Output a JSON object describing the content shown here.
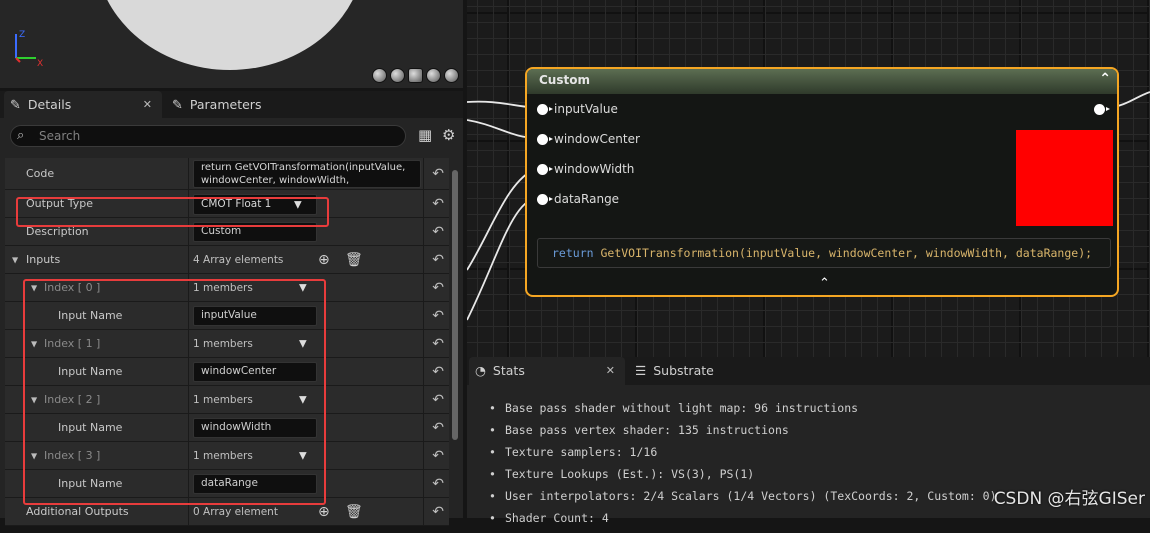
{
  "details": {
    "tabs": [
      {
        "label": "Details",
        "icon": "pencil-icon",
        "closable": true
      },
      {
        "label": "Parameters",
        "icon": "pencil-icon"
      }
    ],
    "search_placeholder": "Search",
    "rows": {
      "code": {
        "label": "Code",
        "value": "return GetVOITransformation(inputValue, windowCenter, windowWidth, dataRange);"
      },
      "output_type": {
        "label": "Output Type",
        "value": "CMOT Float 1"
      },
      "description": {
        "label": "Description",
        "value": "Custom"
      },
      "inputs": {
        "label": "Inputs",
        "value": "4 Array elements"
      },
      "indices": [
        {
          "label": "Index [ 0 ]",
          "members": "1 members",
          "input_label": "Input Name",
          "input_value": "inputValue"
        },
        {
          "label": "Index [ 1 ]",
          "members": "1 members",
          "input_label": "Input Name",
          "input_value": "windowCenter"
        },
        {
          "label": "Index [ 2 ]",
          "members": "1 members",
          "input_label": "Input Name",
          "input_value": "windowWidth"
        },
        {
          "label": "Index [ 3 ]",
          "members": "1 members",
          "input_label": "Input Name",
          "input_value": "dataRange"
        }
      ],
      "additional_outputs": {
        "label": "Additional Outputs",
        "value": "0 Array element"
      }
    }
  },
  "node": {
    "title": "Custom",
    "pins": [
      "inputValue",
      "windowCenter",
      "windowWidth",
      "dataRange"
    ],
    "code_keyword": "return",
    "code_rest": " GetVOITransformation(inputValue, windowCenter, windowWidth, dataRange);",
    "preview_color": "#ff0000",
    "border_color": "#f5a623"
  },
  "stats": {
    "tabs": [
      {
        "label": "Stats",
        "icon": "stats-icon",
        "closable": true
      },
      {
        "label": "Substrate",
        "icon": "list-icon"
      }
    ],
    "lines": [
      "Base pass shader without light map: 96 instructions",
      "Base pass vertex shader: 135 instructions",
      "Texture samplers: 1/16",
      "Texture Lookups (Est.): VS(3), PS(1)",
      "User interpolators: 2/4 Scalars (1/4 Vectors) (TexCoords: 2, Custom: 0)",
      "Shader Count: 4"
    ]
  },
  "watermark": "CSDN @右弦GISer",
  "highlight_color": "#e83c3c"
}
